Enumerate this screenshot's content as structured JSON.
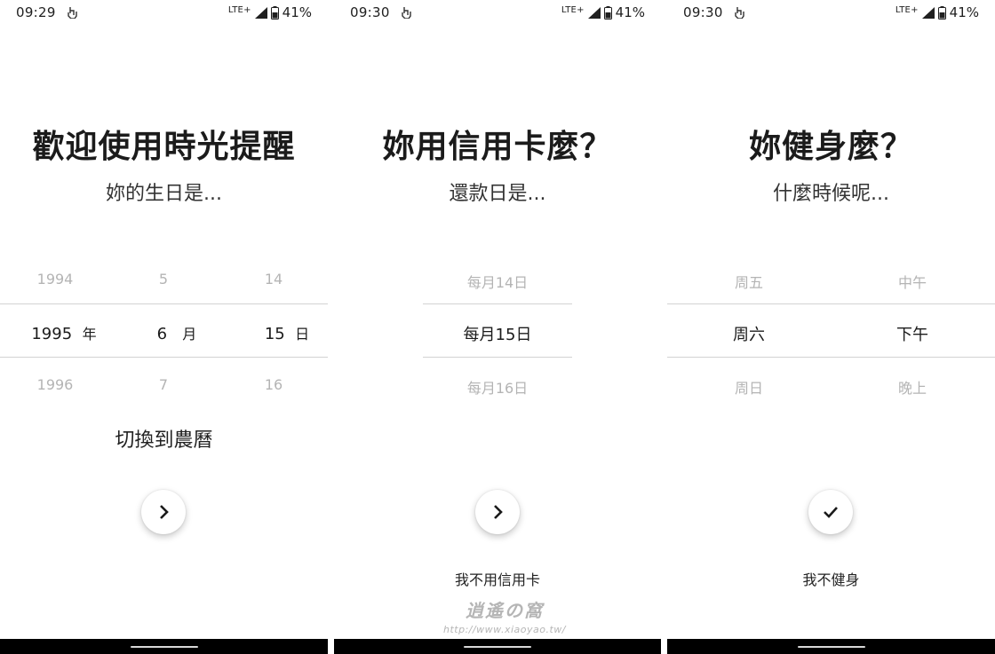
{
  "screens": [
    {
      "status": {
        "time": "09:29",
        "network": "LTE+",
        "battery": "41%"
      },
      "title": "歡迎使用時光提醒",
      "subtitle": "妳的生日是...",
      "picker": {
        "year": {
          "prev": "1994",
          "selected": "1995",
          "unit": "年",
          "next": "1996"
        },
        "month": {
          "prev": "5",
          "selected": "6",
          "unit": "月",
          "next": "7"
        },
        "day": {
          "prev": "14",
          "selected": "15",
          "unit": "日",
          "next": "16"
        }
      },
      "lunar_toggle": "切換到農曆",
      "action_icon": "chevron-right-icon"
    },
    {
      "status": {
        "time": "09:30",
        "network": "LTE+",
        "battery": "41%"
      },
      "title": "妳用信用卡麼？",
      "subtitle": "還款日是...",
      "picker": {
        "prev": "每月14日",
        "selected": "每月15日",
        "next": "每月16日"
      },
      "action_icon": "chevron-right-icon",
      "skip": "我不用信用卡"
    },
    {
      "status": {
        "time": "09:30",
        "network": "LTE+",
        "battery": "41%"
      },
      "title": "妳健身麼？",
      "subtitle": "什麼時候呢...",
      "picker": {
        "day": {
          "prev": "周五",
          "selected": "周六",
          "next": "周日"
        },
        "period": {
          "prev": "中午",
          "selected": "下午",
          "next": "晚上"
        }
      },
      "action_icon": "check-icon",
      "skip": "我不健身"
    }
  ],
  "watermark": {
    "logo": "逍遙の窩",
    "url": "http://www.xiaoyao.tw/"
  }
}
